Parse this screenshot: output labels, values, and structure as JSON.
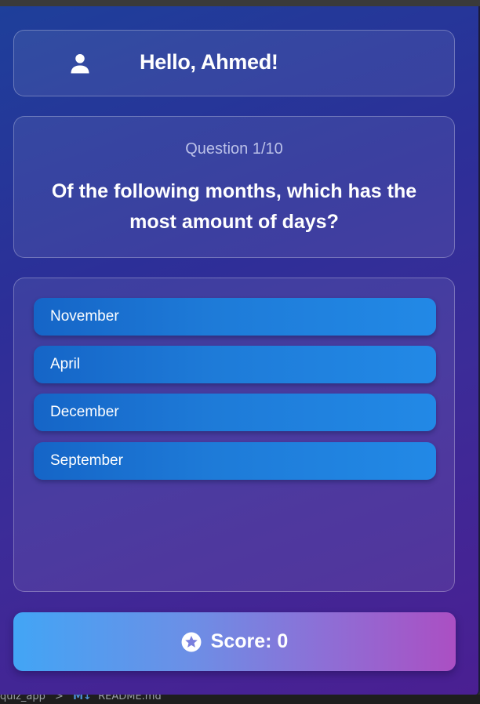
{
  "greeting": {
    "text": "Hello, Ahmed!",
    "icon": "person-icon"
  },
  "question": {
    "counter": "Question 1/10",
    "text": "Of the following months, which has the most amount of days?"
  },
  "answers": [
    {
      "label": "November"
    },
    {
      "label": "April"
    },
    {
      "label": "December"
    },
    {
      "label": "September"
    }
  ],
  "score": {
    "label": "Score: 0",
    "icon": "star-badge-icon"
  },
  "statusbar": {
    "folder": "quiz_app",
    "separator": ">",
    "file_icon": "M↓",
    "file": "README.md"
  },
  "colors": {
    "answer_button": "#1e7bd8",
    "score_gradient_start": "#42a5f5",
    "score_gradient_end": "#ab4fc3",
    "background_start": "#1e3f9a",
    "background_end": "#4a1f92"
  }
}
